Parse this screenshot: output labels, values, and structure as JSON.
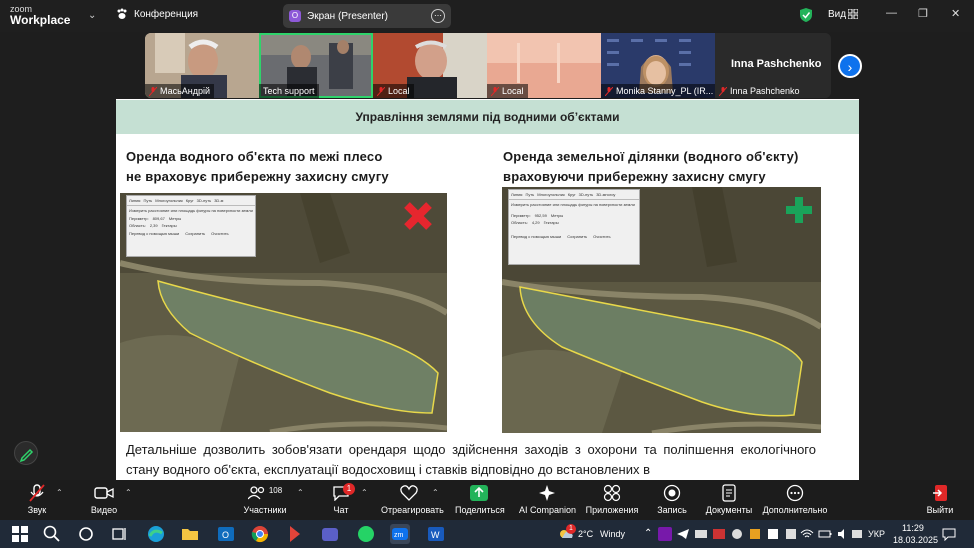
{
  "app": {
    "logo_line1": "zoom",
    "logo_line2": "Workplace",
    "meeting_label": "Конференция"
  },
  "screen_share": {
    "badge": "O",
    "label": "Экран (Presenter)"
  },
  "view": {
    "label": "Вид"
  },
  "participants_strip": [
    {
      "name": "МасьАндрій",
      "muted": true
    },
    {
      "name": "Tech support",
      "muted": false,
      "active": true
    },
    {
      "name": "Local",
      "muted": true
    },
    {
      "name": "Local",
      "muted": true
    },
    {
      "name": "Monika Stanny_PL (IR...",
      "muted": true
    },
    {
      "name": "Inna Pashchenko",
      "muted": true
    }
  ],
  "inna_big_name": "Inna Pashchenko",
  "slide": {
    "header": "Управління землями під водними об’єктами",
    "left_title_1": "Оренда водного об'єкта по межі плесо",
    "left_title_2": "не враховує прибережну захисну смугу",
    "right_title_1": "Оренда земельної ділянки (водного об'єкту)",
    "right_title_2": "враховуючи прибережну захисну смугу",
    "paragraph": "Детальніше дозволить зобов'язати орендаря щодо здійснення заходів з охорони та поліпшення екологічного стану водного об'єкта, експлуатації водосховищ і ставків відповідно до встановлених в",
    "left_dialog": {
      "tabs": [
        "Линия",
        "Путь",
        "Многоугольник",
        "Круг",
        "3D-путь",
        "3D-м"
      ],
      "hint": "Измерить расстояние или площадь фигуры на поверхности земли",
      "perimeter_label": "Периметр:",
      "perimeter_value": "809,67",
      "perimeter_unit": "Метры",
      "area_label": "Область:",
      "area_value": "2,39",
      "area_unit": "Гектары",
      "checkbox": "Перевод с помощью мыши",
      "save": "Сохранить",
      "clear": "Очистить"
    },
    "right_dialog": {
      "tabs": [
        "Линия",
        "Путь",
        "Многоугольник",
        "Круг",
        "3D-путь",
        "3D-многоу"
      ],
      "hint": "Измерить расстояние или площадь фигуры на поверхности земли",
      "perimeter_label": "Периметр:",
      "perimeter_value": "952,59",
      "perimeter_unit": "Метры",
      "area_label": "Область:",
      "area_value": "4,29",
      "area_unit": "Гектары",
      "checkbox": "Перевод с помощью мыши",
      "save": "Сохранить",
      "clear": "Очистить"
    }
  },
  "toolbar": {
    "audio": "Звук",
    "video": "Видео",
    "participants": "Участники",
    "participants_count": "108",
    "chat": "Чат",
    "chat_badge": "1",
    "react": "Отреагировать",
    "share": "Поделиться",
    "ai": "AI Companion",
    "apps": "Приложения",
    "record": "Запись",
    "docs": "Документы",
    "more": "Дополнительно",
    "leave": "Выйти"
  },
  "taskbar": {
    "weather_temp": "2°C",
    "weather_desc": "Windy",
    "weather_badge": "1",
    "lang": "УКР",
    "time": "11:29",
    "date": "18.03.2025"
  },
  "colors": {
    "accent_green": "#2fd36b",
    "zoom_blue": "#0e72ed",
    "slide_header": "#c5e0d3",
    "red_x": "#e6262e",
    "green_plus": "#1aa35a"
  }
}
